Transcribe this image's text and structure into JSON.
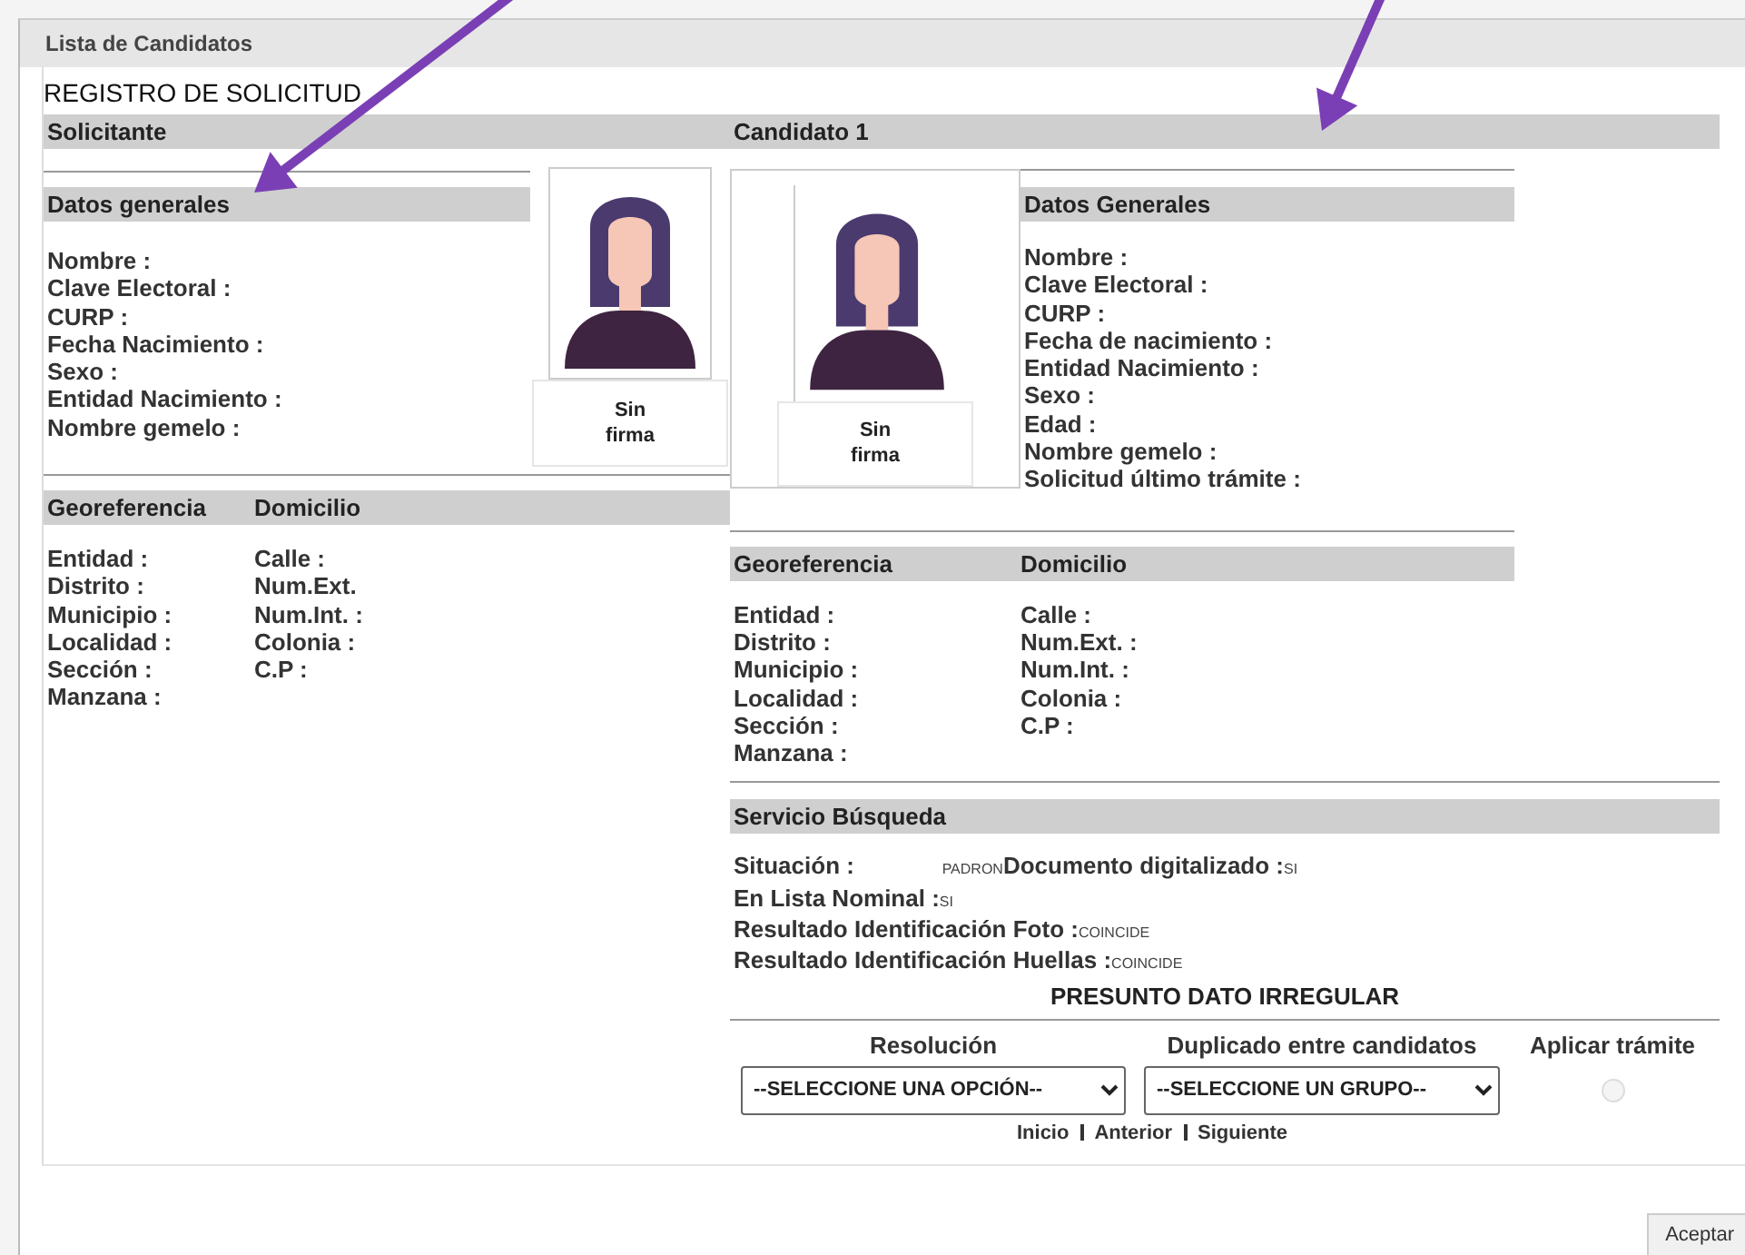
{
  "window": {
    "title": "Lista de Candidatos"
  },
  "heading": "REGISTRO DE SOLICITUD",
  "applicant": {
    "title": "Solicitante",
    "general_title": "Datos generales",
    "signature": "Sin firma",
    "fields": [
      "Nombre :",
      "Clave Electoral :",
      "CURP :",
      "Fecha Nacimiento :",
      "Sexo :",
      "Entidad Nacimiento :",
      "Nombre gemelo :"
    ],
    "georef_title": "Georeferencia",
    "address_title": "Domicilio",
    "georef_fields": [
      "Entidad :",
      "Distrito :",
      "Municipio :",
      "Localidad :",
      "Sección :",
      "Manzana :"
    ],
    "address_fields": [
      "Calle :",
      "Num.Ext.",
      "Num.Int. :",
      "Colonia :",
      "C.P :"
    ]
  },
  "candidate": {
    "title": "Candidato 1",
    "general_title": "Datos Generales",
    "signature": "Sin firma",
    "fields": [
      "Nombre :",
      "Clave Electoral :",
      "CURP :",
      "Fecha de nacimiento :",
      "Entidad Nacimiento :",
      "Sexo :",
      "Edad :",
      "Nombre gemelo :",
      "Solicitud último trámite :"
    ],
    "georef_title": "Georeferencia",
    "address_title": "Domicilio",
    "georef_fields": [
      "Entidad :",
      "Distrito :",
      "Municipio :",
      "Localidad :",
      "Sección :",
      "Manzana :"
    ],
    "address_fields": [
      "Calle :",
      "Num.Ext. :",
      "Num.Int. :",
      "Colonia :",
      "C.P :"
    ]
  },
  "search_service": {
    "title": "Servicio Búsqueda",
    "rows": [
      [
        {
          "label": "Situación :",
          "value": "PADRON"
        },
        {
          "label": "Documento digitalizado :",
          "value": "SI"
        }
      ],
      [
        {
          "label": "En Lista Nominal :",
          "value": "SI"
        }
      ],
      [
        {
          "label": "Resultado Identificación Foto :",
          "value": "COINCIDE"
        }
      ],
      [
        {
          "label": "Resultado Identificación Huellas :",
          "value": "COINCIDE"
        }
      ]
    ]
  },
  "notice": "PRESUNTO DATO IRREGULAR",
  "resolution": {
    "label": "Resolución",
    "value": "--SELECCIONE UNA OPCIÓN--"
  },
  "duplicate": {
    "label": "Duplicado entre candidatos",
    "value": "--SELECCIONE UN GRUPO--"
  },
  "apply": {
    "label": "Aplicar trámite",
    "checked": false,
    "disabled": true
  },
  "pagination": [
    "Inicio",
    "Anterior",
    "Siguiente"
  ],
  "buttons": [
    "Aceptar"
  ]
}
